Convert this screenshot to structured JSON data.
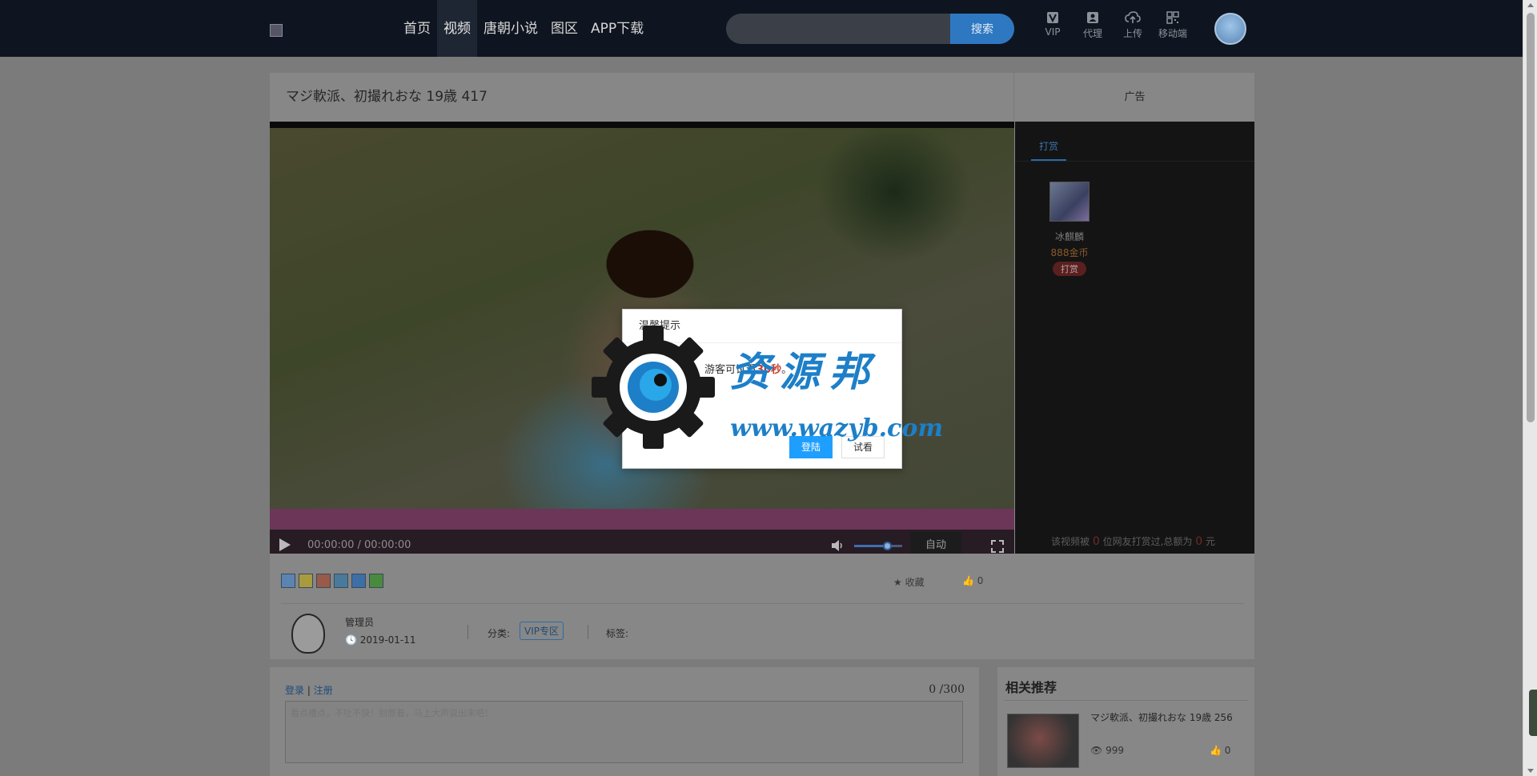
{
  "nav": {
    "items": [
      {
        "label": "首页"
      },
      {
        "label": "视频"
      },
      {
        "label": "唐朝小说"
      },
      {
        "label": "图区"
      },
      {
        "label": "APP下载"
      }
    ],
    "active_index": 1
  },
  "search": {
    "placeholder": "",
    "button_label": "搜索"
  },
  "header_icons": [
    {
      "icon": "vip-icon",
      "label": "VIP"
    },
    {
      "icon": "agent-icon",
      "label": "代理"
    },
    {
      "icon": "upload-icon",
      "label": "上传"
    },
    {
      "icon": "qrcode-icon",
      "label": "移动端"
    }
  ],
  "video": {
    "title": "マジ軟派、初撮れおな 19歳 417",
    "time": "00:00:00 / 00:00:00",
    "auto_label": "自动",
    "volume_percent": 70
  },
  "ad": {
    "label": "广告"
  },
  "reward": {
    "tab_label": "打赏",
    "gift": {
      "name": "冰麒麟",
      "price": "888金币",
      "button": "打赏"
    },
    "summary_prefix": "该视频被",
    "summary_count": "0",
    "summary_middle": "位网友打赏过,总额为",
    "summary_total": "0",
    "summary_suffix": "元"
  },
  "actions": {
    "favorite_label": "收藏",
    "like_count": "0"
  },
  "meta": {
    "author": "管理员",
    "date": "2019-01-11",
    "category_label": "分类:",
    "category": "VIP专区",
    "tags_label": "标签:"
  },
  "comments": {
    "login": "登录",
    "register": "注册",
    "separator": "|",
    "count": "0 /300",
    "placeholder": "看点槽点，不吐不快！别憋着，马上大声说出来吧！"
  },
  "recommend": {
    "title": "相关推荐",
    "items": [
      {
        "title": "マジ軟派、初撮れおな 19歳 256",
        "views": "999",
        "likes": "0"
      }
    ]
  },
  "modal": {
    "title": "温馨提示",
    "message_prefix": "该视频，游客可试看",
    "message_highlight": "30秒",
    "message_suffix": "。",
    "primary_button": "登陆",
    "secondary_button": "试看"
  },
  "watermark": {
    "text": "资源邦",
    "url": "www.wazyb.com"
  },
  "colors": {
    "header_bg": "#0f1520",
    "accent": "#2e78c2",
    "modal_primary": "#1e9fff"
  }
}
